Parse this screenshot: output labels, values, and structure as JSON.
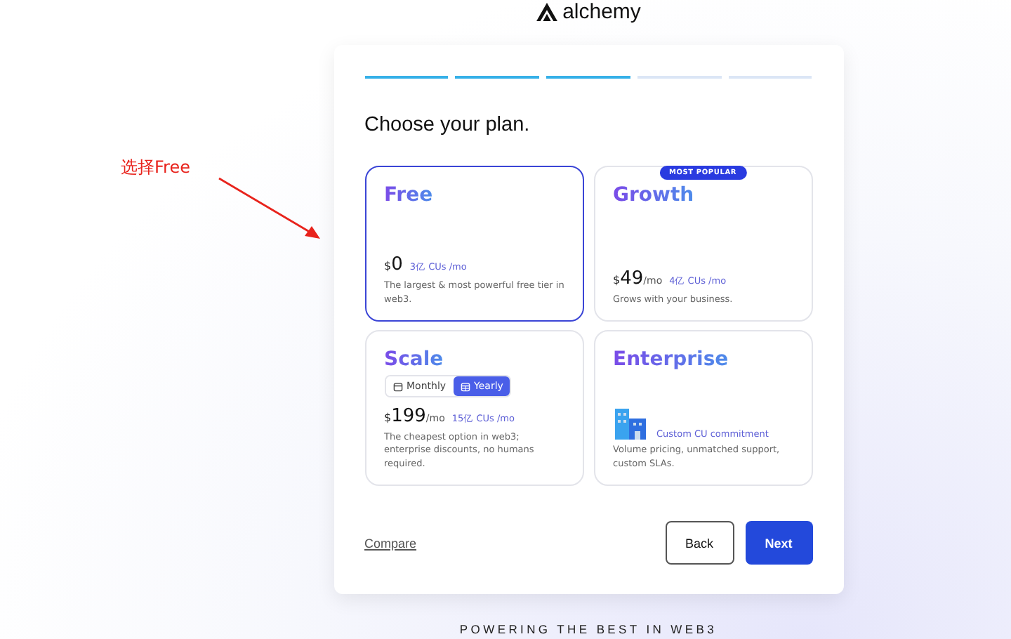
{
  "logo": {
    "text": "alchemy"
  },
  "annotation": {
    "text": "选择Free"
  },
  "progress": [
    {
      "done": true
    },
    {
      "done": true
    },
    {
      "done": true
    },
    {
      "done": false
    },
    {
      "done": false
    }
  ],
  "title": "Choose your plan.",
  "plans": [
    {
      "kind": "price",
      "name": "Free",
      "selected": true,
      "popular": false,
      "currency": "$",
      "price": "0",
      "units": "3亿 CUs /mo",
      "description": "The largest & most powerful free tier in web3."
    },
    {
      "kind": "price",
      "name": "Growth",
      "selected": false,
      "popular": true,
      "currency": "$",
      "price": "49",
      "per": "/mo",
      "units": "4亿 CUs /mo",
      "description": "Grows with your business."
    },
    {
      "kind": "price",
      "name": "Scale",
      "selected": false,
      "popular": false,
      "billing": [
        {
          "label": "Monthly",
          "selected": false
        },
        {
          "label": "Yearly",
          "selected": true
        }
      ],
      "currency": "$",
      "price": "199",
      "per": "/mo",
      "units": "15亿 CUs /mo",
      "description": "The cheapest option in web3; enterprise discounts, no humans required."
    },
    {
      "kind": "custom",
      "name": "Enterprise",
      "selected": false,
      "popular": false,
      "units": "Custom CU commitment",
      "description": "Volume pricing, unmatched support, custom SLAs."
    }
  ],
  "popular_badge": "MOST POPULAR",
  "compare": "Compare",
  "buttons": [
    {
      "kind": "secondary",
      "label": "Back"
    },
    {
      "kind": "primary",
      "label": "Next"
    }
  ],
  "footer": "POWERING THE BEST IN WEB3"
}
